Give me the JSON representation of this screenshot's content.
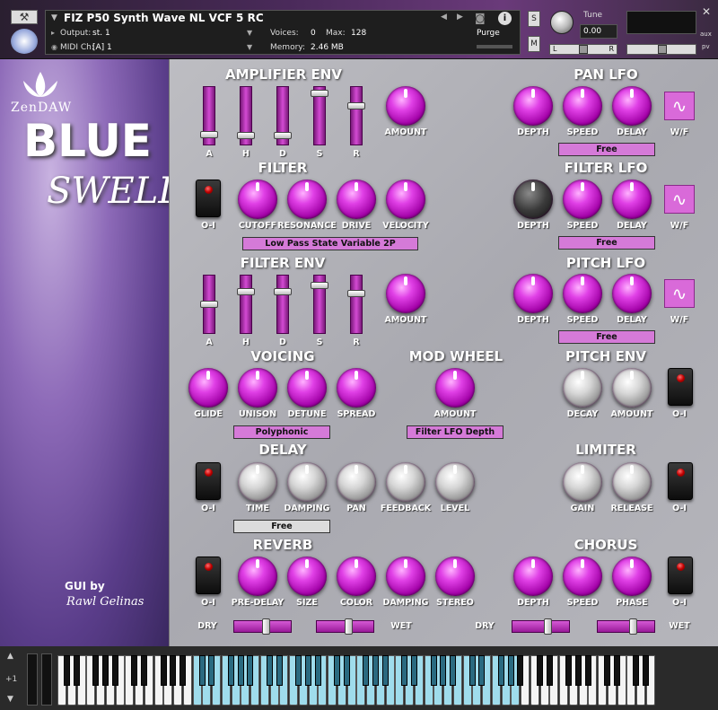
{
  "header": {
    "instrument_name": "FIZ P50 Synth Wave NL VCF 5 RC",
    "output_label": "Output:",
    "output_value": "st. 1",
    "voices_label": "Voices:",
    "voices_value": "0",
    "max_label": "Max:",
    "max_value": "128",
    "midi_label": "MIDI Ch:",
    "midi_value": "[A]  1",
    "memory_label": "Memory:",
    "memory_value": "2.46 MB",
    "purge_label": "Purge",
    "s_label": "S",
    "m_label": "M",
    "tune_label": "Tune",
    "tune_value": "0.00",
    "pan_left": "L",
    "pan_right": "R",
    "aux_label": "aux",
    "pv_label": "pv"
  },
  "sidebar": {
    "brand": "ZenDAW",
    "title_line1": "BLUE",
    "title_line2": "SWELLS",
    "credit_line1": "GUI by",
    "credit_line2": "Rawl Gelinas"
  },
  "amp_env": {
    "title": "AMPLIFIER ENV",
    "sliders": [
      "A",
      "H",
      "D",
      "S",
      "R"
    ],
    "amount": "AMOUNT",
    "levels": [
      0.12,
      0.1,
      0.1,
      0.95,
      0.7
    ]
  },
  "filter": {
    "title": "FILTER",
    "power": "O-I",
    "knobs": [
      "CUTOFF",
      "RESONANCE",
      "DRIVE",
      "VELOCITY"
    ],
    "mode": "Low Pass State Variable 2P"
  },
  "filter_env": {
    "title": "FILTER ENV",
    "sliders": [
      "A",
      "H",
      "D",
      "S",
      "R"
    ],
    "amount": "AMOUNT",
    "levels": [
      0.5,
      0.75,
      0.75,
      0.88,
      0.72
    ]
  },
  "voicing": {
    "title": "VOICING",
    "knobs": [
      "GLIDE",
      "UNISON",
      "DETUNE",
      "SPREAD"
    ],
    "mode": "Polyphonic"
  },
  "mod_wheel": {
    "title": "MOD WHEEL",
    "knob": "AMOUNT",
    "target": "Filter LFO Depth"
  },
  "delay": {
    "title": "DELAY",
    "power": "O-I",
    "knobs": [
      "TIME",
      "DAMPING",
      "PAN",
      "FEEDBACK",
      "LEVEL"
    ],
    "mode": "Free"
  },
  "reverb": {
    "title": "REVERB",
    "power": "O-I",
    "knobs": [
      "PRE-DELAY",
      "SIZE",
      "COLOR",
      "DAMPING",
      "STEREO"
    ],
    "dry": "DRY",
    "wet": "WET",
    "mix": 0.55
  },
  "pan_lfo": {
    "title": "PAN LFO",
    "knobs": [
      "DEPTH",
      "SPEED",
      "DELAY"
    ],
    "wf": "W/F",
    "mode": "Free"
  },
  "filter_lfo": {
    "title": "FILTER LFO",
    "knobs": [
      "DEPTH",
      "SPEED",
      "DELAY"
    ],
    "wf": "W/F",
    "mode": "Free"
  },
  "pitch_lfo": {
    "title": "PITCH LFO",
    "knobs": [
      "DEPTH",
      "SPEED",
      "DELAY"
    ],
    "wf": "W/F",
    "mode": "Free"
  },
  "pitch_env": {
    "title": "PITCH ENV",
    "knobs": [
      "DECAY",
      "AMOUNT"
    ],
    "power": "O-I"
  },
  "limiter": {
    "title": "LIMITER",
    "knobs": [
      "GAIN",
      "RELEASE"
    ],
    "power": "O-I"
  },
  "chorus": {
    "title": "CHORUS",
    "knobs": [
      "DEPTH",
      "SPEED",
      "PHASE"
    ],
    "power": "O-I",
    "dry": "DRY",
    "wet": "WET",
    "mix": 0.62
  },
  "keyboard": {
    "octave": "+1"
  },
  "icons": {
    "wrench": "wrench-icon",
    "camera": "camera-icon",
    "info": "info-icon",
    "wave": "sine-wave-icon"
  }
}
